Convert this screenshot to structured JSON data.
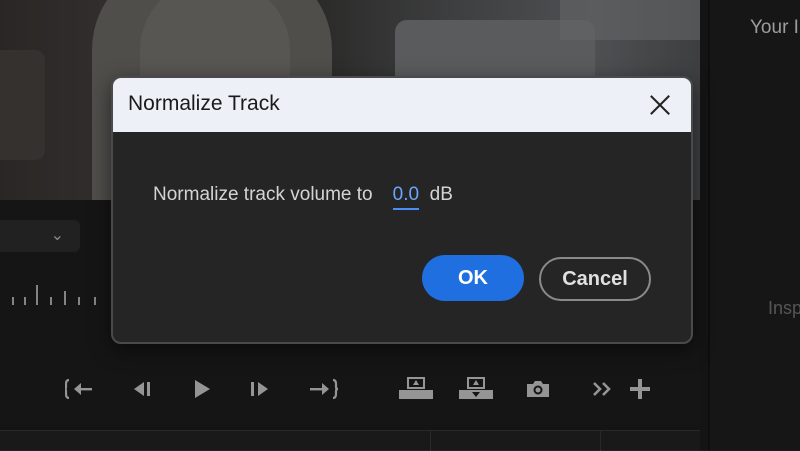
{
  "dialog": {
    "title": "Normalize Track",
    "label": "Normalize track volume to",
    "value": "0.0",
    "unit": "dB",
    "ok_label": "OK",
    "cancel_label": "Cancel"
  },
  "right_panel": {
    "title": "Your I",
    "inspector_label": "Insp"
  },
  "playback_controls": [
    {
      "icon": "go-to-in-icon",
      "glyph": "{←"
    },
    {
      "icon": "step-back-icon",
      "glyph": "◀|"
    },
    {
      "icon": "play-icon",
      "glyph": "▶"
    },
    {
      "icon": "step-forward-icon",
      "glyph": "|▶"
    },
    {
      "icon": "go-to-out-icon",
      "glyph": "→}"
    },
    {
      "icon": "lift-icon",
      "glyph": "⏏"
    },
    {
      "icon": "extract-icon",
      "glyph": "⏏"
    },
    {
      "icon": "camera-icon",
      "glyph": "📷"
    },
    {
      "icon": "more-icon",
      "glyph": "»"
    },
    {
      "icon": "add-icon",
      "glyph": "+"
    }
  ],
  "colors": {
    "accent": "#1f6fe0",
    "dialog_header": "#eef0f8",
    "dialog_body": "#252525"
  }
}
